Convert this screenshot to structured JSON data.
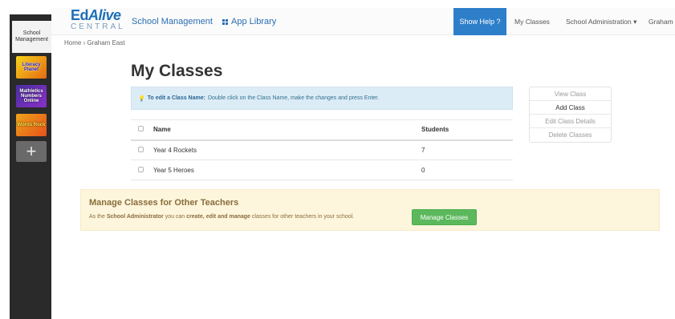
{
  "dock": {
    "active_label": "School Management",
    "apps": [
      {
        "label": "Literacy Planet"
      },
      {
        "label": "Mathletics Numbers Online"
      },
      {
        "label": "Words Rock"
      }
    ],
    "add_label": "+"
  },
  "navbar": {
    "brand_ed": "Ed",
    "brand_alive": "Alive",
    "brand_central": "CENTRAL",
    "app_title": "School Management",
    "app_library": "App Library",
    "help_button": "Show Help ?",
    "my_classes": "My Classes",
    "school_admin": "School Administration ▾",
    "user": "Graham"
  },
  "breadcrumb": "Home › Graham East",
  "page_title": "My Classes",
  "info": {
    "bold_text": "To edit a Class Name:",
    "text": "Double click on the Class Name, make the changes and press Enter."
  },
  "table": {
    "headers": {
      "name": "Name",
      "students": "Students"
    },
    "rows": [
      {
        "name": "Year 4 Rockets",
        "students": "7"
      },
      {
        "name": "Year 5 Heroes",
        "students": "0"
      }
    ]
  },
  "actions": {
    "view": "View Class",
    "add": "Add Class",
    "edit": "Edit Class Details",
    "delete": "Delete Classes"
  },
  "manage": {
    "title": "Manage Classes for Other Teachers",
    "text_1": "As the",
    "role": "School Administrator",
    "text_2": "you can",
    "verbs": "create, edit and manage",
    "text_3": "classes for other teachers in your school.",
    "button": "Manage Classes"
  }
}
